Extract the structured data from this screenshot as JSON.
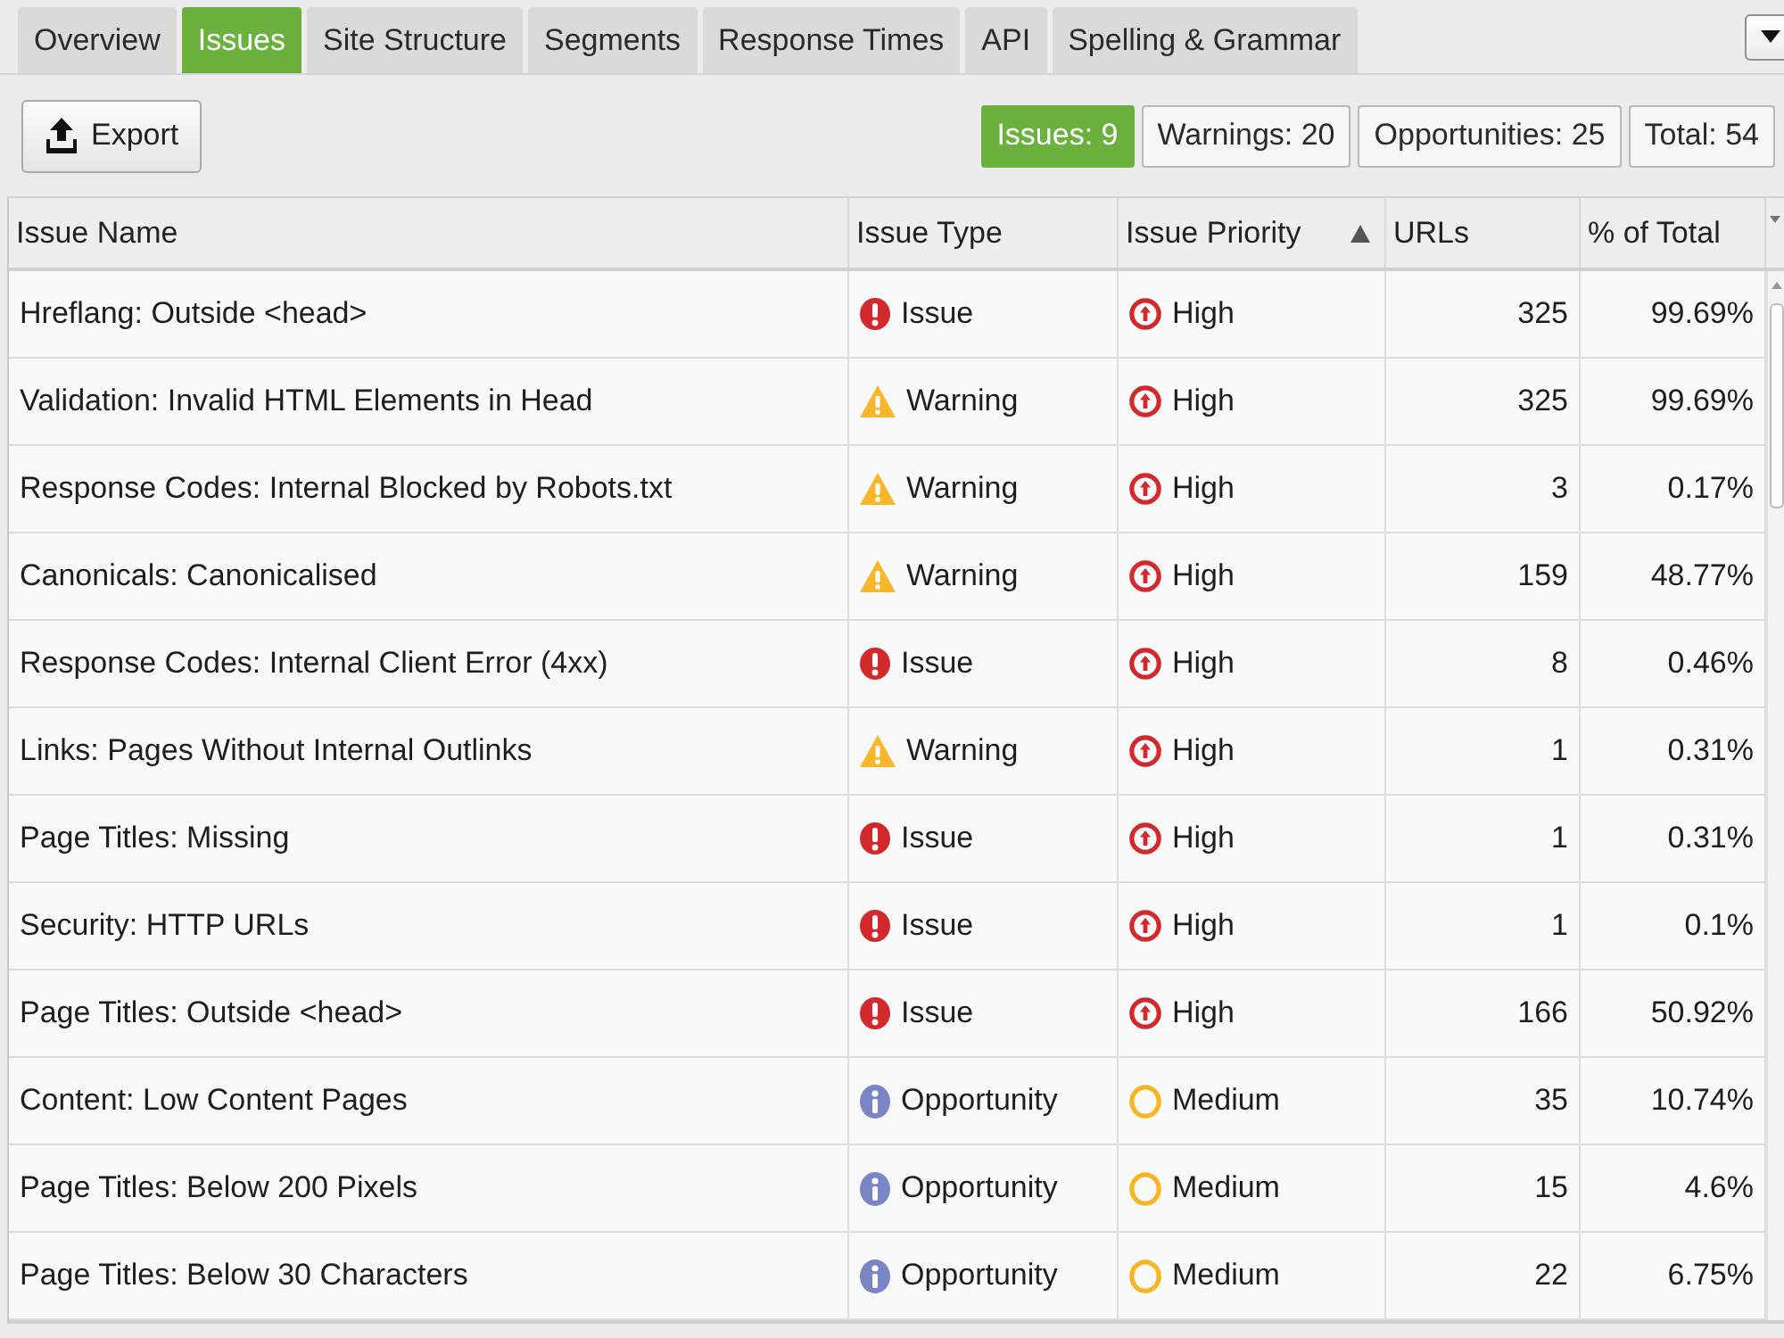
{
  "tabs": [
    {
      "label": "Overview",
      "selected": false
    },
    {
      "label": "Issues",
      "selected": true
    },
    {
      "label": "Site Structure",
      "selected": false
    },
    {
      "label": "Segments",
      "selected": false
    },
    {
      "label": "Response Times",
      "selected": false
    },
    {
      "label": "API",
      "selected": false
    },
    {
      "label": "Spelling & Grammar",
      "selected": false
    }
  ],
  "toolbar": {
    "export_button": "Export",
    "filters": [
      {
        "label": "Issues: 9",
        "selected": true
      },
      {
        "label": "Warnings: 20",
        "selected": false
      },
      {
        "label": "Opportunities: 25",
        "selected": false
      },
      {
        "label": "Total: 54",
        "selected": false
      }
    ]
  },
  "table": {
    "columns": [
      {
        "label": "Issue Name"
      },
      {
        "label": "Issue Type"
      },
      {
        "label": "Issue Priority",
        "sort_ascending": true
      },
      {
        "label": "URLs"
      },
      {
        "label": "% of Total"
      }
    ],
    "rows": [
      {
        "name": "Hreflang: Outside <head>",
        "type": {
          "kind": "issue",
          "label": "Issue"
        },
        "priority": {
          "kind": "high",
          "label": "High"
        },
        "urls": "325",
        "percent": "99.69%"
      },
      {
        "name": "Validation: Invalid HTML Elements in Head",
        "type": {
          "kind": "warning",
          "label": "Warning"
        },
        "priority": {
          "kind": "high",
          "label": "High"
        },
        "urls": "325",
        "percent": "99.69%"
      },
      {
        "name": "Response Codes: Internal Blocked by Robots.txt",
        "type": {
          "kind": "warning",
          "label": "Warning"
        },
        "priority": {
          "kind": "high",
          "label": "High"
        },
        "urls": "3",
        "percent": "0.17%"
      },
      {
        "name": "Canonicals: Canonicalised",
        "type": {
          "kind": "warning",
          "label": "Warning"
        },
        "priority": {
          "kind": "high",
          "label": "High"
        },
        "urls": "159",
        "percent": "48.77%"
      },
      {
        "name": "Response Codes: Internal Client Error (4xx)",
        "type": {
          "kind": "issue",
          "label": "Issue"
        },
        "priority": {
          "kind": "high",
          "label": "High"
        },
        "urls": "8",
        "percent": "0.46%"
      },
      {
        "name": "Links: Pages Without Internal Outlinks",
        "type": {
          "kind": "warning",
          "label": "Warning"
        },
        "priority": {
          "kind": "high",
          "label": "High"
        },
        "urls": "1",
        "percent": "0.31%"
      },
      {
        "name": "Page Titles: Missing",
        "type": {
          "kind": "issue",
          "label": "Issue"
        },
        "priority": {
          "kind": "high",
          "label": "High"
        },
        "urls": "1",
        "percent": "0.31%"
      },
      {
        "name": "Security: HTTP URLs",
        "type": {
          "kind": "issue",
          "label": "Issue"
        },
        "priority": {
          "kind": "high",
          "label": "High"
        },
        "urls": "1",
        "percent": "0.1%"
      },
      {
        "name": "Page Titles: Outside <head>",
        "type": {
          "kind": "issue",
          "label": "Issue"
        },
        "priority": {
          "kind": "high",
          "label": "High"
        },
        "urls": "166",
        "percent": "50.92%"
      },
      {
        "name": "Content: Low Content Pages",
        "type": {
          "kind": "opportunity",
          "label": "Opportunity"
        },
        "priority": {
          "kind": "medium",
          "label": "Medium"
        },
        "urls": "35",
        "percent": "10.74%"
      },
      {
        "name": "Page Titles: Below 200 Pixels",
        "type": {
          "kind": "opportunity",
          "label": "Opportunity"
        },
        "priority": {
          "kind": "medium",
          "label": "Medium"
        },
        "urls": "15",
        "percent": "4.6%"
      },
      {
        "name": "Page Titles: Below 30 Characters",
        "type": {
          "kind": "opportunity",
          "label": "Opportunity"
        },
        "priority": {
          "kind": "medium",
          "label": "Medium"
        },
        "urls": "22",
        "percent": "6.75%"
      }
    ]
  }
}
